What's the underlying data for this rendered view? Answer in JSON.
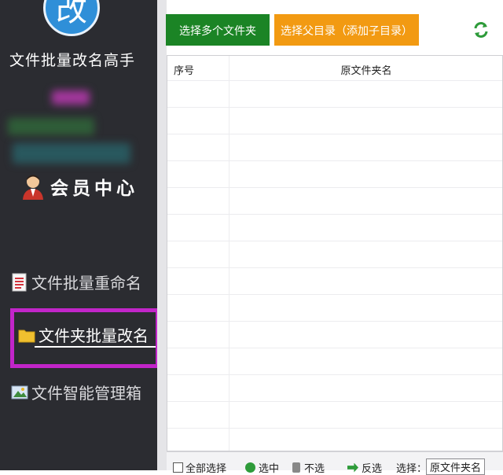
{
  "app": {
    "logo_char": "改",
    "title": "文件批量改名高手"
  },
  "member": {
    "label": "会员中心"
  },
  "nav": [
    {
      "label": "文件批量重命名",
      "icon": "document-icon",
      "active": false
    },
    {
      "label": "文件夹批量改名",
      "icon": "folder-icon",
      "active": true
    },
    {
      "label": "文件智能管理箱",
      "icon": "image-manager-icon",
      "active": false
    }
  ],
  "toolbar": {
    "select_multi_label": "选择多个文件夹",
    "select_parent_label": "选择父目录（添加子目录）",
    "refresh_icon": "refresh-icon"
  },
  "table": {
    "headers": [
      "序号",
      "原文件夹名"
    ],
    "rows": []
  },
  "bottom": {
    "select_all": "全部选择",
    "selected": "选中",
    "unselect": "不选",
    "invert": "反选",
    "filter_label": "选择：",
    "filter_value": "原文件夹名"
  },
  "colors": {
    "sidebar_bg": "#2b2c31",
    "green": "#1b8425",
    "orange": "#f29a12",
    "highlight": "#c225c9"
  }
}
